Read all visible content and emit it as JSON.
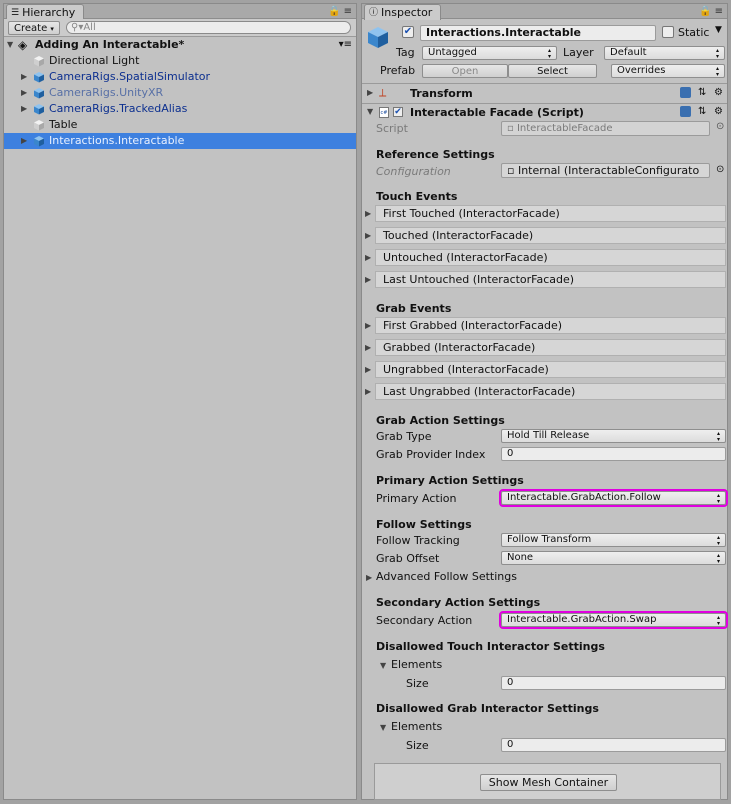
{
  "hierarchy": {
    "tab_label": "Hierarchy",
    "create_label": "Create",
    "search_placeholder": "All",
    "scene_name": "Adding An Interactable*",
    "items": [
      {
        "label": "Directional Light",
        "kind": "object",
        "expandable": false
      },
      {
        "label": "CameraRigs.SpatialSimulator",
        "kind": "prefab",
        "expandable": true
      },
      {
        "label": "CameraRigs.UnityXR",
        "kind": "prefab-inactive",
        "expandable": true
      },
      {
        "label": "CameraRigs.TrackedAlias",
        "kind": "prefab",
        "expandable": true
      },
      {
        "label": "Table",
        "kind": "object",
        "expandable": false
      },
      {
        "label": "Interactions.Interactable",
        "kind": "prefab-inactive",
        "expandable": true,
        "selected": true
      }
    ]
  },
  "inspector": {
    "tab_label": "Inspector",
    "object_name": "Interactions.Interactable",
    "active_checked": true,
    "static_label": "Static",
    "tag_label": "Tag",
    "tag_value": "Untagged",
    "layer_label": "Layer",
    "layer_value": "Default",
    "prefab_label": "Prefab",
    "open_label": "Open",
    "select_label": "Select",
    "overrides_label": "Overrides",
    "transform_label": "Transform",
    "component_title": "Interactable Facade (Script)",
    "script_label": "Script",
    "script_value": "InteractableFacade",
    "reference_settings": "Reference Settings",
    "configuration_label": "Configuration",
    "configuration_value": "Internal (InteractableConfigurato",
    "touch_events": "Touch Events",
    "touch_items": [
      "First Touched (InteractorFacade)",
      "Touched (InteractorFacade)",
      "Untouched (InteractorFacade)",
      "Last Untouched (InteractorFacade)"
    ],
    "grab_events": "Grab Events",
    "grab_items": [
      "First Grabbed (InteractorFacade)",
      "Grabbed (InteractorFacade)",
      "Ungrabbed (InteractorFacade)",
      "Last Ungrabbed (InteractorFacade)"
    ],
    "grab_action_settings": "Grab Action Settings",
    "grab_type_label": "Grab Type",
    "grab_type_value": "Hold Till Release",
    "grab_provider_label": "Grab Provider Index",
    "grab_provider_value": "0",
    "primary_action_settings": "Primary Action Settings",
    "primary_action_label": "Primary Action",
    "primary_action_value": "Interactable.GrabAction.Follow",
    "follow_settings": "Follow Settings",
    "follow_tracking_label": "Follow Tracking",
    "follow_tracking_value": "Follow Transform",
    "grab_offset_label": "Grab Offset",
    "grab_offset_value": "None",
    "advanced_follow_label": "Advanced Follow Settings",
    "secondary_action_settings": "Secondary Action Settings",
    "secondary_action_label": "Secondary Action",
    "secondary_action_value": "Interactable.GrabAction.Swap",
    "disallowed_touch": "Disallowed Touch Interactor Settings",
    "disallowed_grab": "Disallowed Grab Interactor Settings",
    "elements_label": "Elements",
    "size_label": "Size",
    "touch_size_value": "0",
    "grab_size_value": "0",
    "show_mesh_label": "Show Mesh Container"
  },
  "colors": {
    "highlight": "#e000e0",
    "selection": "#3d80df",
    "prefab_text": "#0c2f8f"
  }
}
